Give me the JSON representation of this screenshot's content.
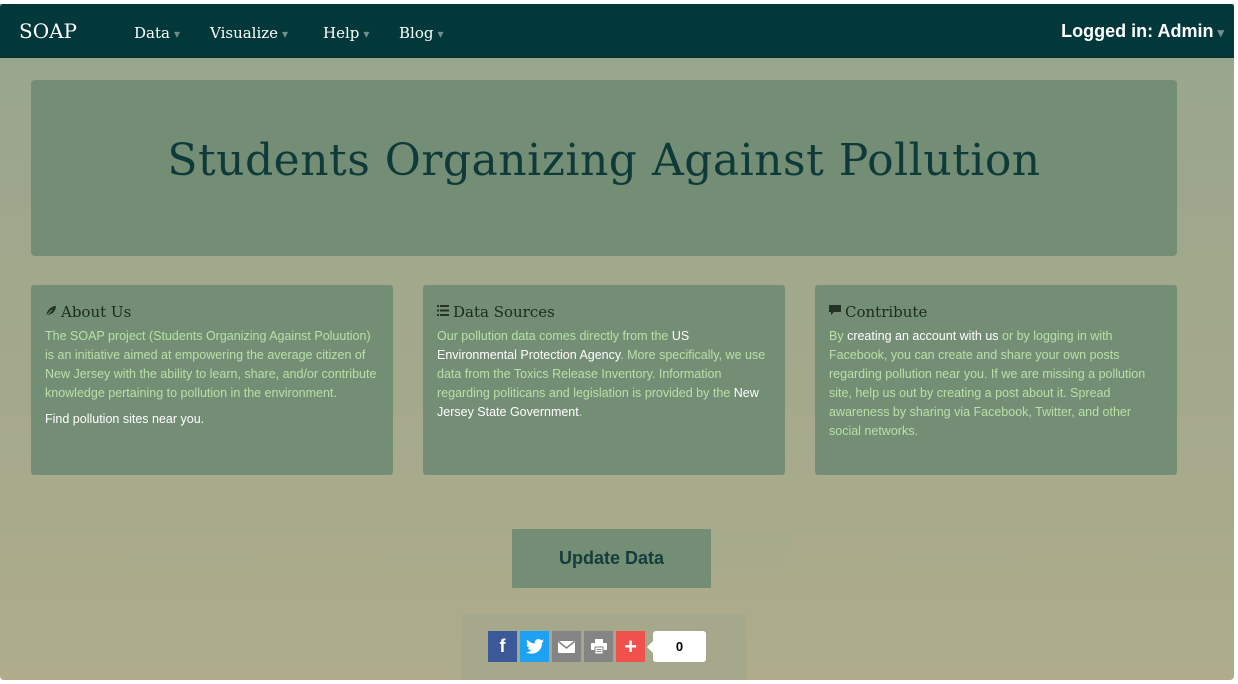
{
  "navbar": {
    "brand": "SOAP",
    "menu": [
      {
        "label": "Data"
      },
      {
        "label": "Visualize"
      },
      {
        "label": "Help"
      },
      {
        "label": "Blog"
      }
    ],
    "user_label": "Logged in: Admin"
  },
  "hero": {
    "title": "Students Organizing Against Pollution"
  },
  "panels": {
    "about": {
      "icon": "leaf-icon",
      "title": "About Us",
      "body": "The SOAP project (Students Organizing Against Poluution) is an initiative aimed at empowering the average citizen of New Jersey with the ability to learn, share, and/or contribute knowledge pertaining to pollution in the environment.",
      "link": "Find pollution sites near you."
    },
    "sources": {
      "icon": "list-icon",
      "title": "Data Sources",
      "text1": "Our pollution data comes directly from the ",
      "link1": "US Environmental Protection Agency",
      "text2": ". More specifically, we use data from the Toxics Release Inventory. Information regarding politicans and legislation is provided by the ",
      "link2": "New Jersey State Government",
      "text3": "."
    },
    "contribute": {
      "icon": "comment-icon",
      "title": "Contribute",
      "text1": "By ",
      "link1": "creating an account with us",
      "text2": " or by logging in with Facebook, you can create and share your own posts regarding pollution near you. If we are missing a pollution site, help us out by creating a post about it. Spread awareness by sharing via Facebook, Twitter, and other social networks."
    }
  },
  "update_button": "Update Data",
  "share": {
    "facebook_label": "f",
    "plus_label": "+",
    "count": "0"
  },
  "colors": {
    "navbar": "#02383a",
    "panel": "#738e74",
    "panel_text": "#b8e0a8",
    "title": "#0f3a3a"
  }
}
